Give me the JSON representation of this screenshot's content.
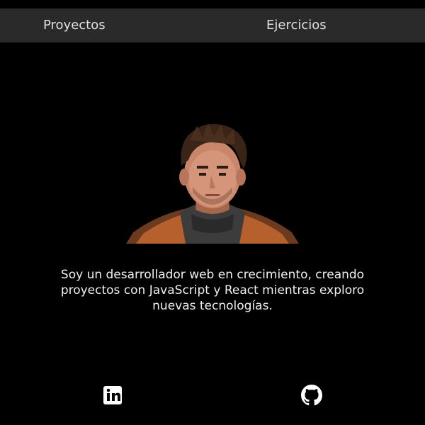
{
  "nav": {
    "projects_label": "Proyectos",
    "exercises_label": "Ejercicios"
  },
  "profile": {
    "avatar_icon": "pixel-art-portrait",
    "intro_text": "Soy un desarrollador web en crecimiento, creando proyectos con JavaScript y React mientras exploro nuevas tecnologías."
  },
  "social": {
    "linkedin_icon": "linkedin-icon",
    "github_icon": "github-icon"
  },
  "colors": {
    "background": "#000000",
    "topbar": "#2a2a2a",
    "text": "#f0f0f0",
    "jacket": "#b5602d"
  }
}
